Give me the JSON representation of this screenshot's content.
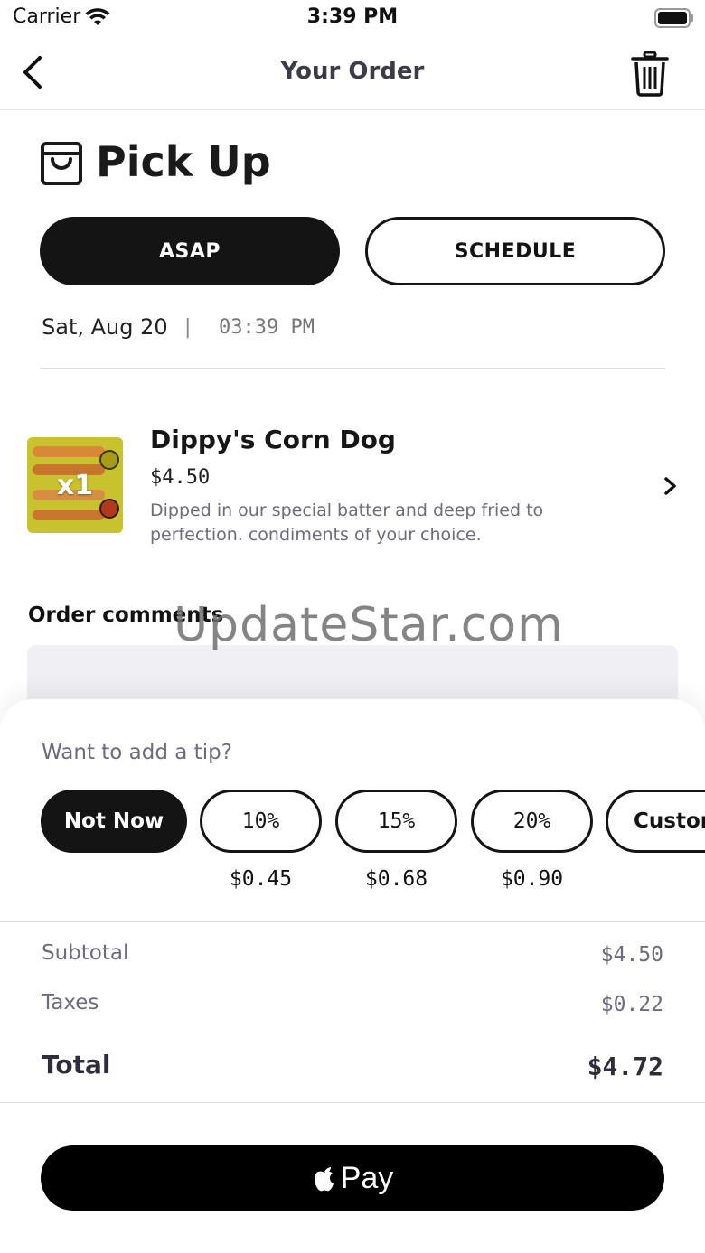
{
  "status_bar": {
    "carrier": "Carrier",
    "time": "3:39 PM"
  },
  "nav": {
    "title": "Your Order",
    "back_icon": "chevron-left-icon",
    "trash_icon": "trash-icon"
  },
  "pickup": {
    "title": "Pick Up",
    "icon": "shopping-bag-icon",
    "asap_label": "ASAP",
    "schedule_label": "SCHEDULE",
    "selected": "ASAP",
    "date": "Sat, Aug 20",
    "separator": "|",
    "time": "03:39 PM"
  },
  "item": {
    "name": "Dippy's Corn Dog",
    "price": "$4.50",
    "quantity": "x1",
    "description": "Dipped in our special batter and deep fried to perfection. condiments of your choice."
  },
  "comments": {
    "label": "Order comments",
    "value": "",
    "placeholder": ""
  },
  "watermark": "UpdateStar.com",
  "tip": {
    "prompt": "Want to add a tip?",
    "options": [
      {
        "label": "Not Now",
        "amount": "",
        "selected": true
      },
      {
        "label": "10%",
        "amount": "$0.45",
        "selected": false
      },
      {
        "label": "15%",
        "amount": "$0.68",
        "selected": false
      },
      {
        "label": "20%",
        "amount": "$0.90",
        "selected": false
      },
      {
        "label": "Custom",
        "amount": "",
        "selected": false
      }
    ]
  },
  "summary": {
    "subtotal_label": "Subtotal",
    "subtotal_value": "$4.50",
    "taxes_label": "Taxes",
    "taxes_value": "$0.22",
    "total_label": "Total",
    "total_value": "$4.72"
  },
  "pay": {
    "label": "Pay",
    "icon": "apple-logo-icon"
  },
  "colors": {
    "primary": "#141414",
    "muted_text": "#6c6b80",
    "divider": "#dcdcdc",
    "item_image": "#c8c22e"
  }
}
